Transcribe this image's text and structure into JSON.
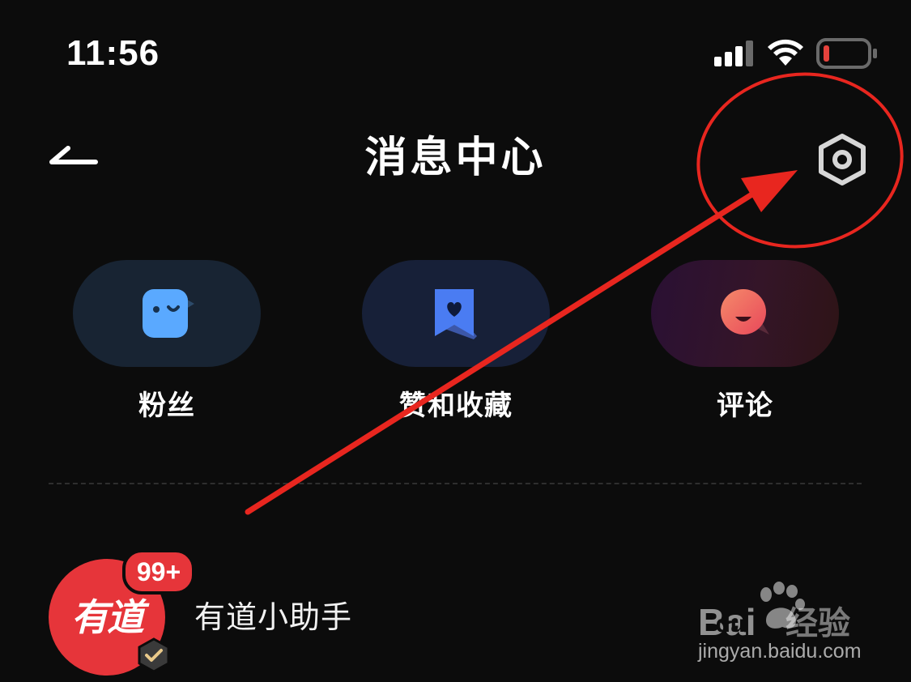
{
  "status_bar": {
    "time": "11:56",
    "icons": [
      "signal-icon",
      "wifi-icon",
      "battery-low-icon"
    ],
    "battery_color": "#e5423c"
  },
  "header": {
    "title": "消息中心",
    "back_icon": "back-arrow-icon",
    "settings_icon": "settings-gear-icon"
  },
  "categories": [
    {
      "label": "粉丝",
      "icon": "fans-face-icon",
      "color": "#5aa9ff"
    },
    {
      "label": "赞和收藏",
      "icon": "heart-bookmark-icon",
      "color": "#4a7cf2"
    },
    {
      "label": "评论",
      "icon": "comment-smile-icon",
      "color": "#f0605a"
    }
  ],
  "messages": [
    {
      "name": "有道小助手",
      "avatar_text": "有道",
      "badge": "99+",
      "verified_icon": "verified-check-icon"
    }
  ],
  "watermark": {
    "logo_text": "Bai",
    "logo_sub": "du",
    "product": "经验",
    "url": "jingyan.baidu.com"
  },
  "annotation_color": "#e8261f"
}
